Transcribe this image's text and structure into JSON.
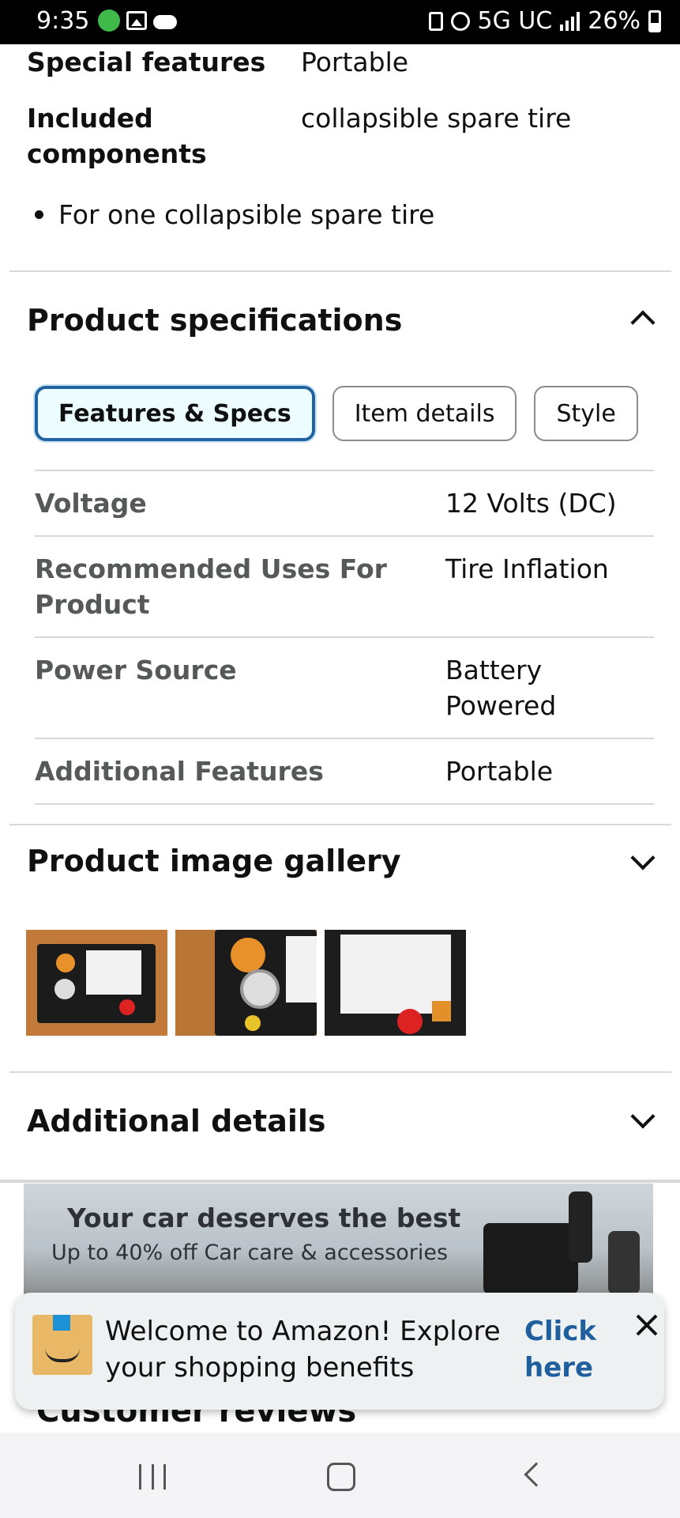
{
  "status_bar": {
    "time": "9:35",
    "network": "5G UC",
    "battery": "26%"
  },
  "features": [
    {
      "label": "Special features",
      "value": "Portable"
    },
    {
      "label": "Included components",
      "value": "collapsible spare tire"
    }
  ],
  "bullets": [
    "For one collapsible spare tire"
  ],
  "specs_section": {
    "title": "Product specifications",
    "tabs": [
      {
        "label": "Features & Specs",
        "active": true
      },
      {
        "label": "Item details",
        "active": false
      },
      {
        "label": "Style",
        "active": false
      }
    ],
    "rows": [
      {
        "label": "Voltage",
        "value": "12 Volts (DC)"
      },
      {
        "label": "Recommended Uses For Product",
        "value": "Tire Inflation"
      },
      {
        "label": "Power Source",
        "value": "Battery Powered"
      },
      {
        "label": "Additional Features",
        "value": "Portable"
      }
    ]
  },
  "gallery_section": {
    "title": "Product image gallery"
  },
  "details_section": {
    "title": "Additional details"
  },
  "banner": {
    "headline": "Your car deserves the best",
    "subline": "Up to 40% off Car care & accessories"
  },
  "toast": {
    "message": "Welcome to Amazon! Explore your shopping benefits",
    "link": "Click here"
  },
  "reviews_section": {
    "title": "Customer reviews"
  },
  "colors": {
    "active_tab_border": "#2162a1",
    "link": "#1f5f9e"
  }
}
